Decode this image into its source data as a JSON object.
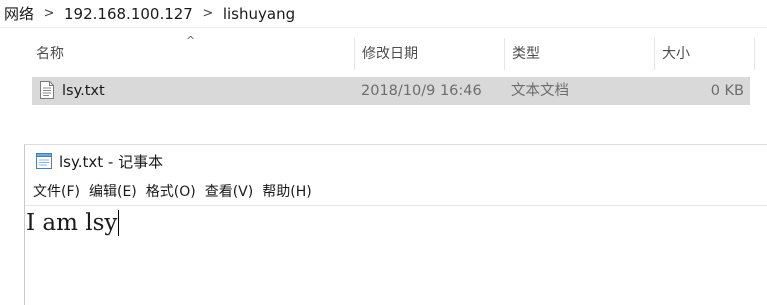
{
  "breadcrumb": {
    "items": [
      "网络",
      "192.168.100.127",
      "lishuyang"
    ],
    "separator": ">"
  },
  "file_list": {
    "sort_indicator": "^",
    "columns": [
      "名称",
      "修改日期",
      "类型",
      "大小"
    ],
    "rows": [
      {
        "name": "lsy.txt",
        "modified": "2018/10/9 16:46",
        "type": "文本文档",
        "size": "0 KB",
        "icon": "text-file-icon",
        "selected": true
      }
    ]
  },
  "notepad": {
    "icon": "notepad-icon",
    "title": "lsy.txt - 记事本",
    "menu": [
      "文件(F)",
      "编辑(E)",
      "格式(O)",
      "查看(V)",
      "帮助(H)"
    ],
    "content": "I am lsy"
  },
  "colors": {
    "selection": "#d9d9d9",
    "secondary_text": "#6d6d6d"
  }
}
